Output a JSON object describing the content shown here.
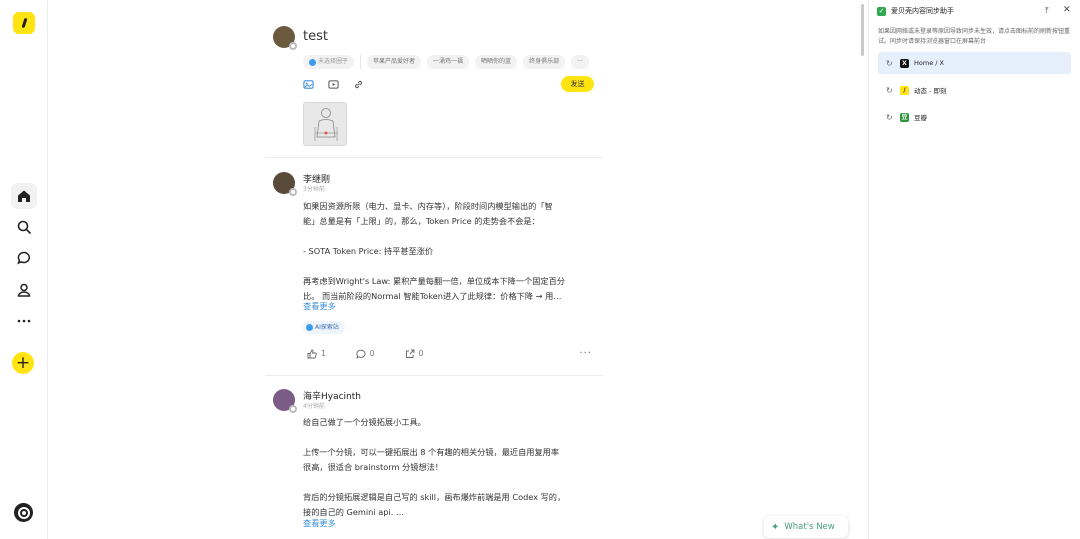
{
  "composer": {
    "name": "test",
    "chips": [
      "未选择圈子",
      "苹果产品爱好者",
      "一涌鸡一福",
      "晒晒你的蓝",
      "终身俱乐部",
      "···"
    ],
    "send_label": "发送"
  },
  "posts": [
    {
      "author": "李继刚",
      "time": "3分钟前",
      "lines": [
        "如果因资源所限（电力、显卡、内存等），阶段时间内模型输出的「智",
        "能」总量是有「上限」的，那么，Token Price 的走势会不会是：",
        "",
        "- SOTA Token Price: 持平甚至涨价",
        "",
        "再考虑到Wright's Law: 累积产量每翻一倍，单位成本下降一个固定百分",
        "比。 而当前阶段的Normal 智能Token进入了此规律：价格下降 → 用…"
      ],
      "more_label": "查看更多",
      "tag": "AI探索站",
      "likes": "1",
      "comments": "0",
      "shares": "0"
    },
    {
      "author": "海辛Hyacinth",
      "time": "4分钟前",
      "lines": [
        "给自己做了一个分镜拓展小工具。",
        "",
        "上传一个分镜，可以一键拓展出 8 个有趣的相关分镜，最近自用复用率",
        "很高，很适合 brainstorm 分镜想法！",
        "",
        "背后的分镜拓展逻辑是自己写的 skill，画布爆炸前端是用 Codex 写的，",
        "接的自己的 Gemini api. …"
      ],
      "more_label": "查看更多"
    }
  ],
  "whats_new": "What's New",
  "panel": {
    "title": "爱贝壳内容同步助手",
    "note": "如果因网络或未登录等原因导致同步未生效，请点击图标前的刷新按钮重试。同步时请保持浏览器窗口在屏幕前台",
    "items": [
      {
        "label": "Home / X",
        "icon": "X",
        "color": "#111111"
      },
      {
        "label": "动态 - 即刻",
        "icon": "/",
        "color": "#ffe411"
      },
      {
        "label": "豆瓣",
        "icon": "豆",
        "color": "#2e963d"
      }
    ]
  },
  "colors": {
    "accent": "#ffe411",
    "link": "#3b8fd9",
    "panel_active": "#e6f0fc"
  }
}
